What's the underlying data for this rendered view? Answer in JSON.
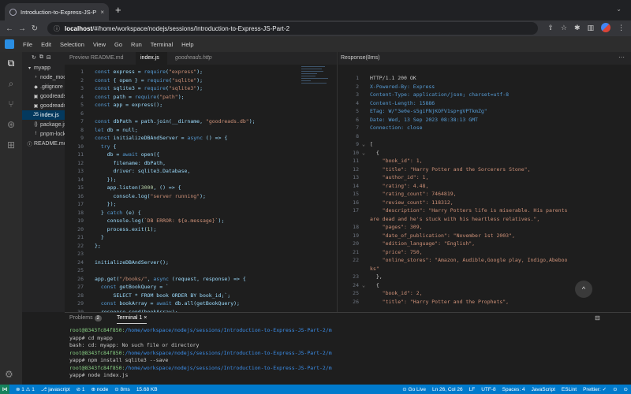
{
  "browser": {
    "tab_title": "Introduction-to-Express-JS-Pa",
    "tab_close": "×",
    "new_tab": "+",
    "tab_dropdown": "⌄",
    "back": "←",
    "forward": "→",
    "reload": "↻",
    "url_host": "localhost",
    "url_path": "/#/home/workspace/nodejs/sessions/Introduction-to-Express-JS-Part-2",
    "icons": [
      "share-icon",
      "star-icon",
      "extensions-icon",
      "sidebar-icon",
      "profile-icon",
      "menu-icon"
    ]
  },
  "menu": [
    "File",
    "Edit",
    "Selection",
    "View",
    "Go",
    "Run",
    "Terminal",
    "Help"
  ],
  "explorer": {
    "toolbar": [
      "↻",
      "⧉",
      "⊟"
    ],
    "items": [
      {
        "label": "myapp",
        "icon": "▾",
        "indent": 0
      },
      {
        "label": "node_modules",
        "icon": "›",
        "indent": 1
      },
      {
        "label": ".gitignore",
        "icon": "◆",
        "indent": 1
      },
      {
        "label": "goodreads.db",
        "icon": "▣",
        "indent": 1
      },
      {
        "label": "goodreads.http",
        "icon": "▣",
        "indent": 1
      },
      {
        "label": "index.js",
        "icon": "JS",
        "indent": 1,
        "selected": true
      },
      {
        "label": "package.json",
        "icon": "{}",
        "indent": 1
      },
      {
        "label": "pnpm-lock.yaml",
        "icon": "!",
        "indent": 1
      },
      {
        "label": "README.md",
        "icon": "ⓘ",
        "indent": 0
      }
    ]
  },
  "editor": {
    "tabs": [
      {
        "label": "Preview README.md",
        "active": false,
        "italic": false
      },
      {
        "label": "index.js",
        "active": true,
        "italic": false
      },
      {
        "label": "goodreads.http",
        "active": false,
        "italic": true
      }
    ],
    "lines": [
      "const express = require(\"express\");",
      "const { open } = require(\"sqlite\");",
      "const sqlite3 = require(\"sqlite3\");",
      "const path = require(\"path\");",
      "const app = express();",
      "",
      "const dbPath = path.join(__dirname, \"goodreads.db\");",
      "let db = null;",
      "const initializeDBAndServer = async () => {",
      "  try {",
      "    db = await open({",
      "      filename: dbPath,",
      "      driver: sqlite3.Database,",
      "    });",
      "    app.listen(3000, () => {",
      "      console.log(\"server running\");",
      "    });",
      "  } catch (e) {",
      "    console.log(`DB ERROR: ${e.message}`);",
      "    process.exit(1);",
      "  }",
      "};",
      "",
      "initializeDBAndServer();",
      "",
      "app.get(\"/books/\", async (request, response) => {",
      "  const getBookQuery = `",
      "      SELECT * FROM book ORDER BY book_id;`;",
      "  const bookArray = await db.all(getBookQuery);",
      "  response.send(bookArray);",
      "});"
    ]
  },
  "response": {
    "tab_label": "Response(8ms)",
    "more": "···",
    "lines": [
      {
        "n": "1",
        "f": "",
        "t": "HTTP/1.1 200 OK",
        "c": "#cccccc"
      },
      {
        "n": "2",
        "f": "",
        "t": "X-Powered-By: Express",
        "c": "#569cd6"
      },
      {
        "n": "3",
        "f": "",
        "t": "Content-Type: application/json; charset=utf-8",
        "c": "#569cd6"
      },
      {
        "n": "4",
        "f": "",
        "t": "Content-Length: 15886",
        "c": "#569cd6"
      },
      {
        "n": "5",
        "f": "",
        "t": "ETag: W/\"3e0e-s5giFNjKOFV1sp+gVPTkmZg\"",
        "c": "#569cd6"
      },
      {
        "n": "6",
        "f": "",
        "t": "Date: Wed, 13 Sep 2023 08:38:13 GMT",
        "c": "#569cd6"
      },
      {
        "n": "7",
        "f": "",
        "t": "Connection: close",
        "c": "#569cd6"
      },
      {
        "n": "8",
        "f": "",
        "t": "",
        "c": "#cccccc"
      },
      {
        "n": "9",
        "f": "⌄",
        "t": "[",
        "c": "#cccccc"
      },
      {
        "n": "10",
        "f": "⌄",
        "t": "  {",
        "c": "#cccccc"
      },
      {
        "n": "11",
        "f": "",
        "t": "    \"book_id\": 1,",
        "c": "#ce9178"
      },
      {
        "n": "12",
        "f": "",
        "t": "    \"title\": \"Harry Potter and the Sorcerers Stone\",",
        "c": "#ce9178"
      },
      {
        "n": "13",
        "f": "",
        "t": "    \"author_id\": 1,",
        "c": "#ce9178"
      },
      {
        "n": "14",
        "f": "",
        "t": "    \"rating\": 4.48,",
        "c": "#ce9178"
      },
      {
        "n": "15",
        "f": "",
        "t": "    \"rating_count\": 7464819,",
        "c": "#ce9178"
      },
      {
        "n": "16",
        "f": "",
        "t": "    \"review_count\": 118312,",
        "c": "#ce9178"
      },
      {
        "n": "17",
        "f": "",
        "t": "    \"description\": \"Harry Potters life is miserable. His parents",
        "c": "#ce9178"
      },
      {
        "n": "",
        "f": "",
        "t": "are dead and he's stuck with his heartless relatives.\",",
        "c": "#ce9178"
      },
      {
        "n": "18",
        "f": "",
        "t": "    \"pages\": 309,",
        "c": "#ce9178"
      },
      {
        "n": "19",
        "f": "",
        "t": "    \"date_of_publication\": \"November 1st 2003\",",
        "c": "#ce9178"
      },
      {
        "n": "20",
        "f": "",
        "t": "    \"edition_language\": \"English\",",
        "c": "#ce9178"
      },
      {
        "n": "21",
        "f": "",
        "t": "    \"price\": 750,",
        "c": "#ce9178"
      },
      {
        "n": "22",
        "f": "",
        "t": "    \"online_stores\": \"Amazon, Audible,Google play, Indigo,Abeboo",
        "c": "#ce9178"
      },
      {
        "n": "",
        "f": "",
        "t": "ks\"",
        "c": "#ce9178"
      },
      {
        "n": "23",
        "f": "",
        "t": "  },",
        "c": "#cccccc"
      },
      {
        "n": "24",
        "f": "⌄",
        "t": "  {",
        "c": "#cccccc"
      },
      {
        "n": "25",
        "f": "",
        "t": "    \"book_id\": 2,",
        "c": "#ce9178"
      },
      {
        "n": "26",
        "f": "",
        "t": "    \"title\": \"Harry Potter and the Prophets\",",
        "c": "#ce9178"
      }
    ],
    "scroll_top": "^"
  },
  "panel": {
    "tabs": [
      {
        "label": "Problems",
        "badge": "2",
        "active": false
      },
      {
        "label": "Terminal 1",
        "badge": "",
        "active": true
      }
    ],
    "tab_close": "×",
    "side_icon": "⊟",
    "lines": [
      {
        "prompt": "root@8343fc84f850:",
        "path": "/home/workspace/nodejs/sessions/Introduction-to-Express-JS-Part-2/m",
        "rest": ""
      },
      {
        "prompt": "",
        "path": "",
        "rest": "yapp# cd myapp"
      },
      {
        "prompt": "",
        "path": "",
        "rest": "bash: cd: myapp: No such file or directory"
      },
      {
        "prompt": "root@8343fc84f850:",
        "path": "/home/workspace/nodejs/sessions/Introduction-to-Express-JS-Part-2/m",
        "rest": ""
      },
      {
        "prompt": "",
        "path": "",
        "rest": "yapp# npm install sqlite3 --save"
      },
      {
        "prompt": "root@8343fc84f850:",
        "path": "/home/workspace/nodejs/sessions/Introduction-to-Express-JS-Part-2/m",
        "rest": ""
      },
      {
        "prompt": "",
        "path": "",
        "rest": "yapp# node index.js"
      }
    ]
  },
  "status": {
    "left": [
      "⊗ 1 ⚠ 1",
      "⎇ javascript",
      "⊘ 1",
      "⊕ node",
      "⊙ 8ms",
      "15.68 KB"
    ],
    "right": [
      "⊙ Go Live",
      "Ln 26, Col 26",
      "LF",
      "UTF-8",
      "Spaces: 4",
      "JavaScript",
      "ESLint",
      "Prettier: ✓",
      "⊙",
      "⊙"
    ]
  },
  "colors": {
    "accent": "#007acc",
    "keyword": "#569cd6",
    "string": "#ce9178",
    "function": "#dcdcaa",
    "prompt_green": "#89d185",
    "prompt_blue": "#3b8eea"
  }
}
